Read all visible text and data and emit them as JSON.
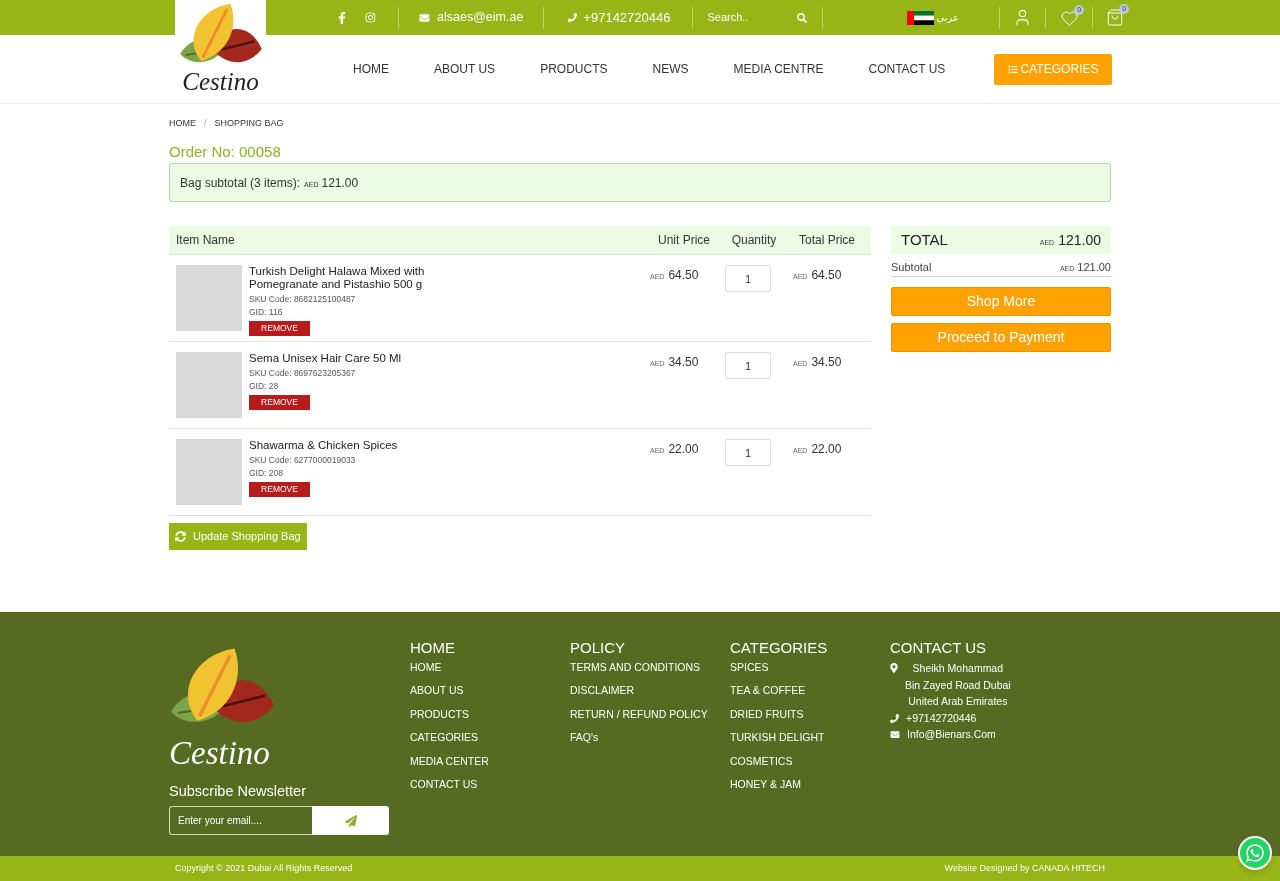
{
  "top_bar": {
    "email": "alsaes@eim.ae",
    "phone": "+97142720446",
    "search": {
      "placeholder": "Search.."
    },
    "language": "عربي",
    "wishlist_count": "0",
    "cart_count": "0"
  },
  "logo": {
    "text": "Cestino"
  },
  "nav": {
    "items": [
      "HOME",
      "ABOUT US",
      "PRODUCTS",
      "NEWS",
      "MEDIA CENTRE",
      "CONTACT US"
    ],
    "categories_button": "CATEGORIES"
  },
  "breadcrumb": {
    "items": [
      "HOME",
      "SHOPPING BAG"
    ],
    "separator": "/"
  },
  "order_title": "Order No: 00058",
  "subtotal_alert": {
    "label": "Bag subtotal (3 items):",
    "currency": "AED",
    "amount": "121.00"
  },
  "cart_table": {
    "columns": [
      "Item Name",
      "Unit Price",
      "Quantity",
      "Total Price"
    ],
    "rows": [
      {
        "name": "Turkish Delight Halawa Mixed with Pomegranate and Pistashio 500 g",
        "sku": "SKU Code: 8682125100487",
        "gid": "GID: 116",
        "remove": "REMOVE",
        "unit_currency": "AED",
        "unit_price": "64.50",
        "quantity": "1",
        "total_currency": "AED",
        "total_price": "64.50"
      },
      {
        "name": "Sema Unisex Hair Care 50 Ml",
        "sku": "SKU Code: 8697623205367",
        "gid": "GID: 28",
        "remove": "REMOVE",
        "unit_currency": "AED",
        "unit_price": "34.50",
        "quantity": "1",
        "total_currency": "AED",
        "total_price": "34.50"
      },
      {
        "name": "Shawarma & Chicken Spices",
        "sku": "SKU Code: 6277000019033",
        "gid": "GID: 208",
        "remove": "REMOVE",
        "unit_currency": "AED",
        "unit_price": "22.00",
        "quantity": "1",
        "total_currency": "AED",
        "total_price": "22.00"
      }
    ]
  },
  "update_button": "Update Shopping Bag",
  "summary": {
    "total_label": "TOTAL",
    "total_currency": "AED",
    "total_amount": "121.00",
    "subtotal_label": "Subtotal",
    "subtotal_currency": "AED",
    "subtotal_amount": "121.00",
    "buttons": [
      "Shop More",
      "Proceed to Payment"
    ]
  },
  "footer": {
    "logo_text": "Cestino",
    "newsletter": {
      "title": "Subscribe Newsletter",
      "placeholder": "Enter your email...."
    },
    "columns": [
      {
        "kind": "links",
        "title": "HOME",
        "items": [
          "HOME",
          "ABOUT US",
          "PRODUCTS",
          "CATEGORIES",
          "MEDIA CENTER",
          "CONTACT US"
        ]
      },
      {
        "kind": "links",
        "title": "POLICY",
        "items": [
          "TERMS AND CONDITIONS",
          "DISCLAIMER",
          "RETURN / REFUND POLICY",
          "FAQ's"
        ]
      },
      {
        "kind": "links",
        "title": "CATEGORIES",
        "items": [
          "SPICES",
          "TEA & COFFEE",
          "DRIED FRUITS",
          "TURKISH DELIGHT",
          "COSMETICS",
          "HONEY & JAM"
        ]
      },
      {
        "kind": "contact",
        "title": "CONTACT US",
        "address": [
          "Sheikh Mohammad",
          "Bin Zayed Road Dubai",
          "United Arab Emirates"
        ],
        "phone": "+97142720446",
        "email": "Info@Bienars.Com"
      }
    ]
  },
  "bottom_bar": {
    "copyright": "Copyright © 2021 Dubai All Rights Reserved",
    "credit": "Website Designed by CANADA HITECH"
  }
}
